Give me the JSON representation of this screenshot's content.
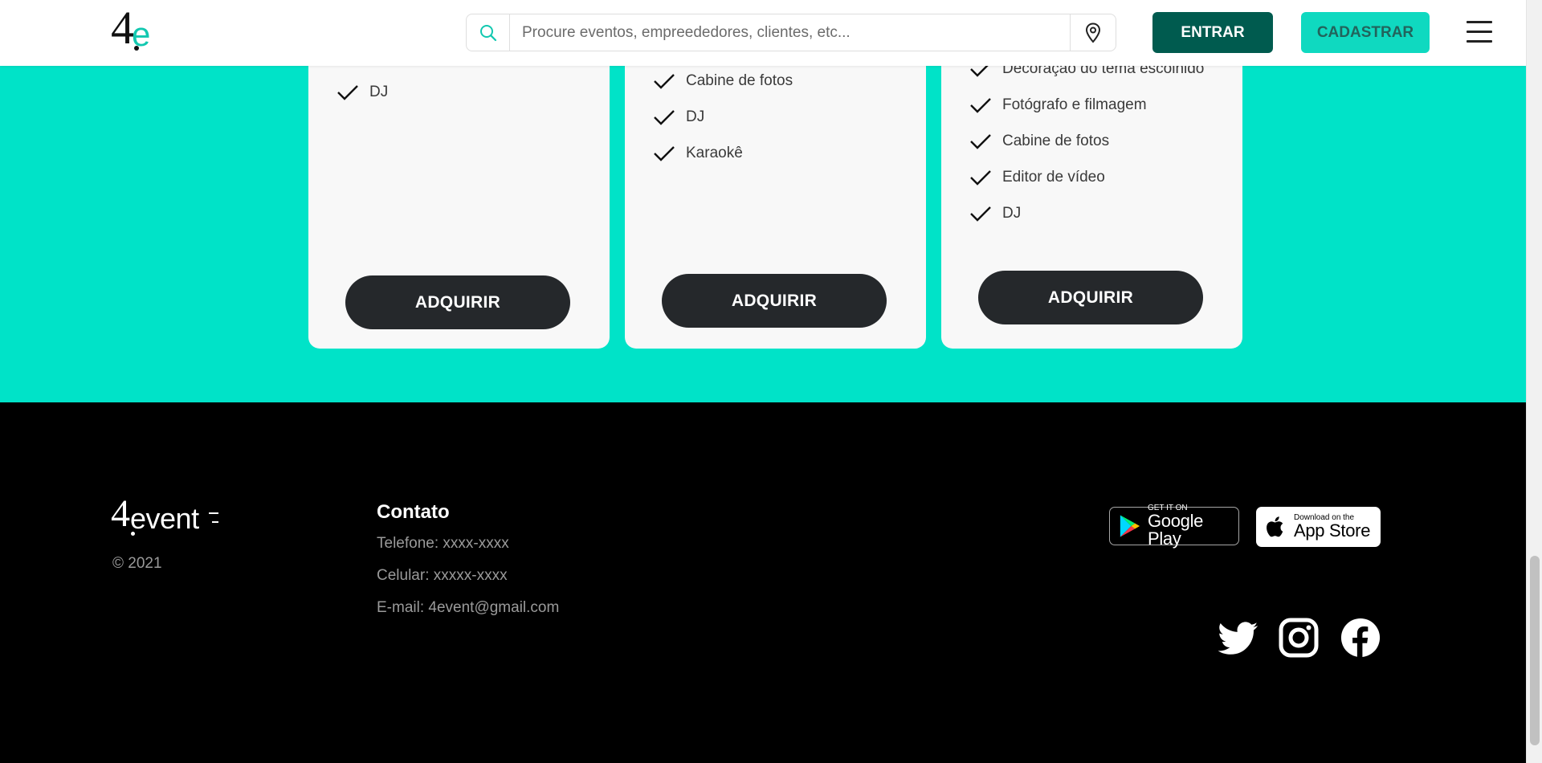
{
  "header": {
    "logo_text": "4e",
    "search_placeholder": "Procure eventos, empreededores, clientes, etc...",
    "login_label": "ENTRAR",
    "signup_label": "CADASTRAR"
  },
  "plans": [
    {
      "items": [
        "DJ"
      ],
      "button_label": "ADQUIRIR"
    },
    {
      "items": [
        "Cabine de fotos",
        "DJ",
        "Karaokê"
      ],
      "button_label": "ADQUIRIR"
    },
    {
      "items": [
        "Decoração do tema escolhido",
        "Fotógrafo e filmagem",
        "Cabine de fotos",
        "Editor de vídeo",
        "DJ"
      ],
      "button_label": "ADQUIRIR"
    }
  ],
  "footer": {
    "logo_text": "4event",
    "copyright": "© 2021",
    "contact": {
      "title": "Contato",
      "phone": "Telefone: xxxx-xxxx",
      "mobile": "Celular: xxxxx-xxxx",
      "email": "E-mail: 4event@gmail.com"
    },
    "google_play": {
      "small": "GET IT ON",
      "big": "Google Play"
    },
    "app_store": {
      "small": "Download on the",
      "big": "App Store"
    },
    "social": [
      "twitter-icon",
      "instagram-icon",
      "facebook-icon"
    ]
  },
  "colors": {
    "teal_band": "#00e3c8",
    "dark_button": "#25282b",
    "login_button": "#005b4f",
    "signup_button": "#0fd9c0"
  }
}
